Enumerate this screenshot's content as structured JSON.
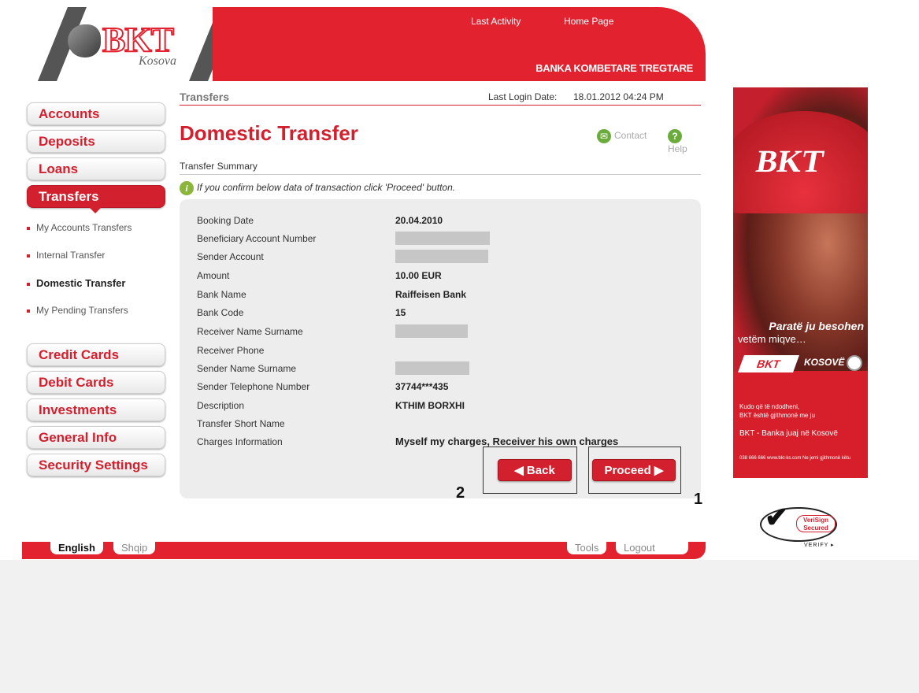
{
  "header": {
    "logo_text": "BKT",
    "logo_sub": "Kosova",
    "links": [
      "Last Activity",
      "Home Page"
    ],
    "bank_name": "BANKA KOMBETARE TREGTARE",
    "brand_color": "#e32230"
  },
  "sidebar": {
    "items_top": [
      "Accounts",
      "Deposits",
      "Loans",
      "Transfers"
    ],
    "active": "Transfers",
    "sub_items": [
      "My Accounts Transfers",
      "Internal Transfer",
      "Domestic Transfer",
      "My Pending Transfers"
    ],
    "current_sub": "Domestic Transfer",
    "items_bottom": [
      "Credit Cards",
      "Debit Cards",
      "Investments",
      "General Info",
      "Security Settings"
    ]
  },
  "main": {
    "breadcrumb": "Transfers",
    "last_login_label": "Last Login Date:",
    "last_login_value": "18.01.2012 04:24 PM",
    "page_title": "Domestic Transfer",
    "contact_label": "Contact",
    "help_label": "Help",
    "section_label": "Transfer Summary",
    "info_message": "If you confirm below data of transaction click 'Proceed' button.",
    "summary": {
      "booking_date_label": "Booking Date",
      "booking_date_value": "20.04.2010",
      "beneficiary_account_label": "Beneficiary Account Number",
      "sender_account_label": "Sender Account",
      "amount_label": "Amount",
      "amount_value": "10.00 EUR",
      "bank_name_label": "Bank Name",
      "bank_name_value": "Raiffeisen Bank",
      "bank_code_label": "Bank Code",
      "bank_code_value": "15",
      "receiver_name_label": "Receiver Name Surname",
      "receiver_phone_label": "Receiver Phone",
      "sender_name_label": "Sender Name Surname",
      "sender_phone_label": "Sender Telephone Number",
      "sender_phone_value": "37744***435",
      "description_label": "Description",
      "description_value": "KTHIM BORXHI",
      "transfer_short_name_label": "Transfer Short Name",
      "charges_label": "Charges Information",
      "charges_value": "Myself my charges, Receiver his own charges"
    },
    "back_button": "◀ Back",
    "proceed_button": "Proceed ▶",
    "annotation_back": "2",
    "annotation_proceed": "1"
  },
  "footer": {
    "lang_english": "English",
    "lang_shqip": "Shqip",
    "tools": "Tools",
    "logout": "Logout"
  },
  "ad": {
    "brand": "BKT",
    "tagline_1": "Paratë ju besohen",
    "tagline_2": "vetëm miqve…",
    "logo_small": "BKT",
    "kosove": "KOSOVË",
    "small_line_1": "Kudo që të ndodheni,",
    "small_line_2": "BKT është gjithmonë me ju",
    "slogan": "BKT - Banka juaj në Kosovë",
    "contact": "038 666 666  www.bkt-ks.com  Ne jemi gjithmonë këtu"
  },
  "verisign": {
    "line_1": "VeriSign",
    "line_2": "Secured",
    "verify": "VERIFY ▸"
  }
}
